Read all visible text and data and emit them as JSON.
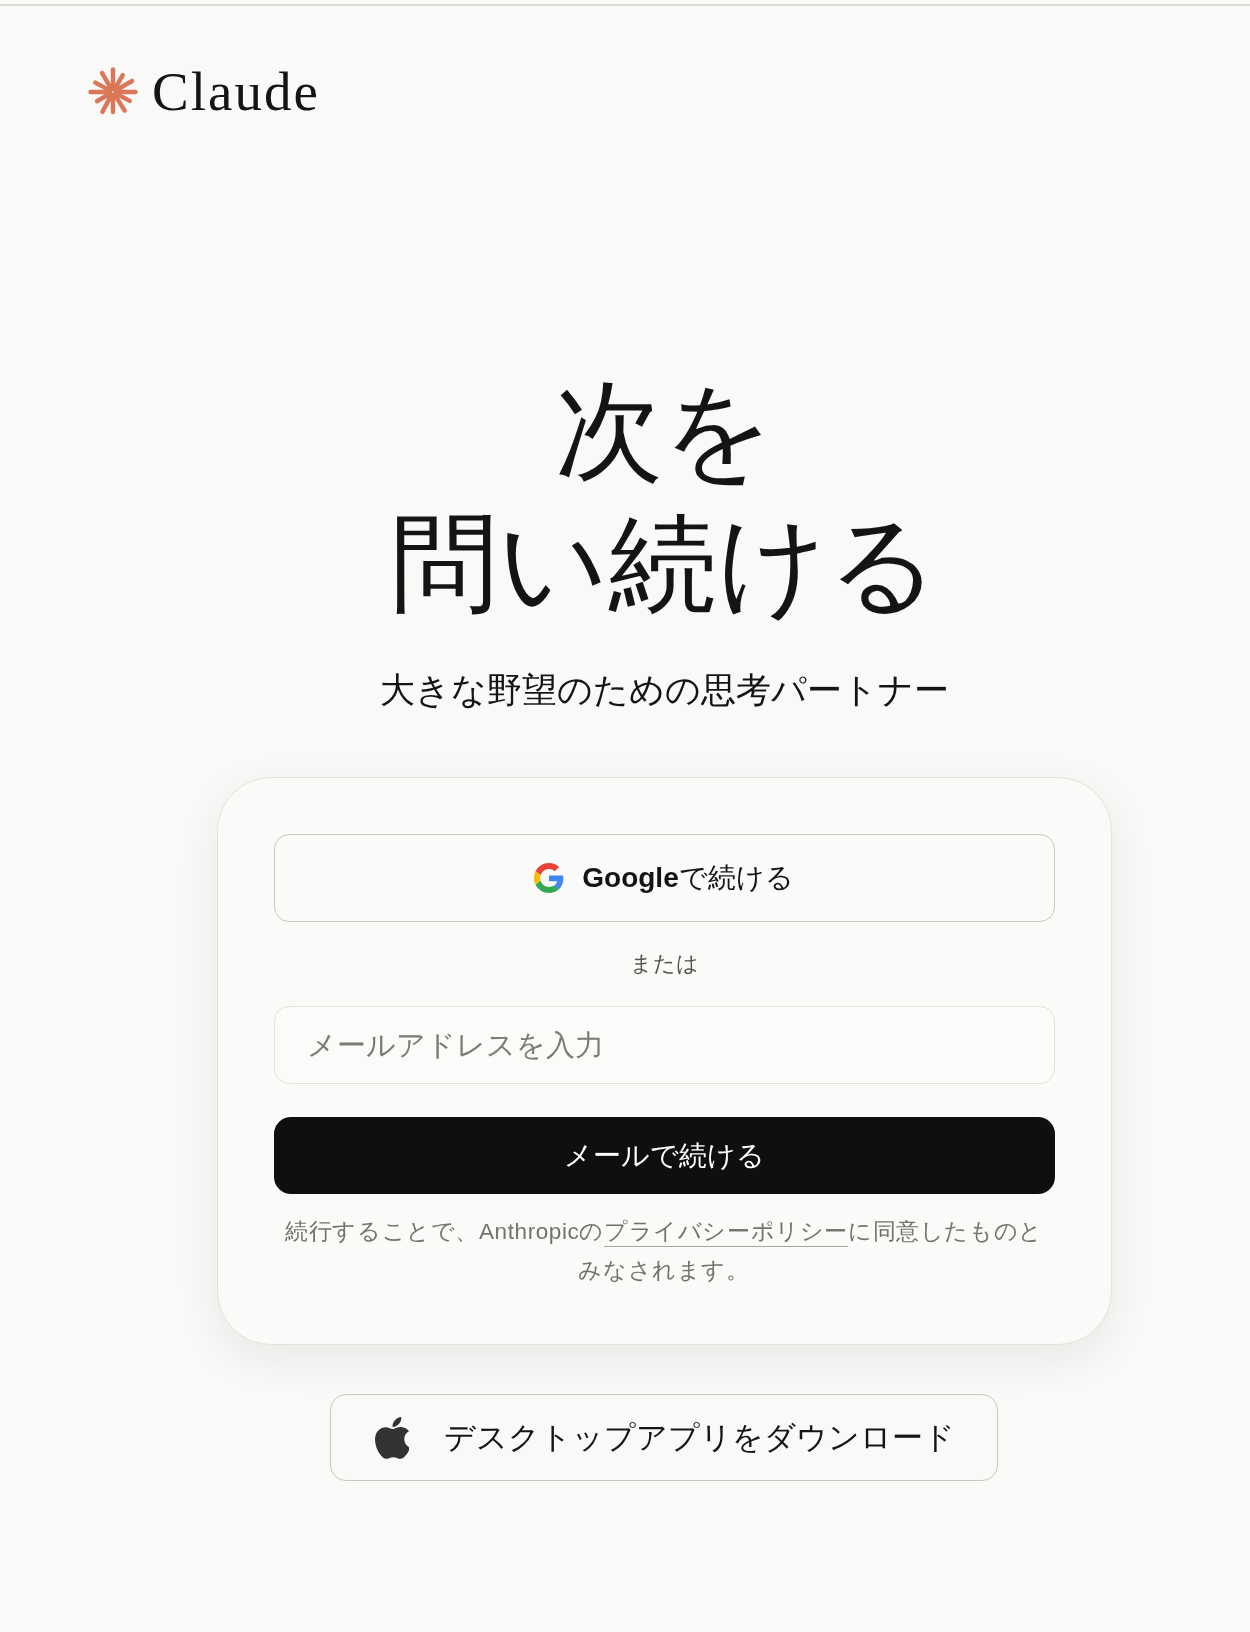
{
  "header": {
    "logo_text": "Claude"
  },
  "hero": {
    "title_lines": [
      "次を",
      "問い続ける"
    ],
    "subtitle": "大きな野望のための思考パートナー"
  },
  "login_card": {
    "google_button": "**Google**で続ける",
    "separator": "または",
    "email_field": {
      "placeholder": "メールアドレスを入力"
    },
    "email_button": "メールで続ける",
    "legal": {
      "text_before": "続行することで、Anthropicの",
      "link": "プライバシーポリシー",
      "text_after": "に同意したものとみなされます。"
    }
  },
  "download_button": "デスクトップアプリをダウンロード"
}
